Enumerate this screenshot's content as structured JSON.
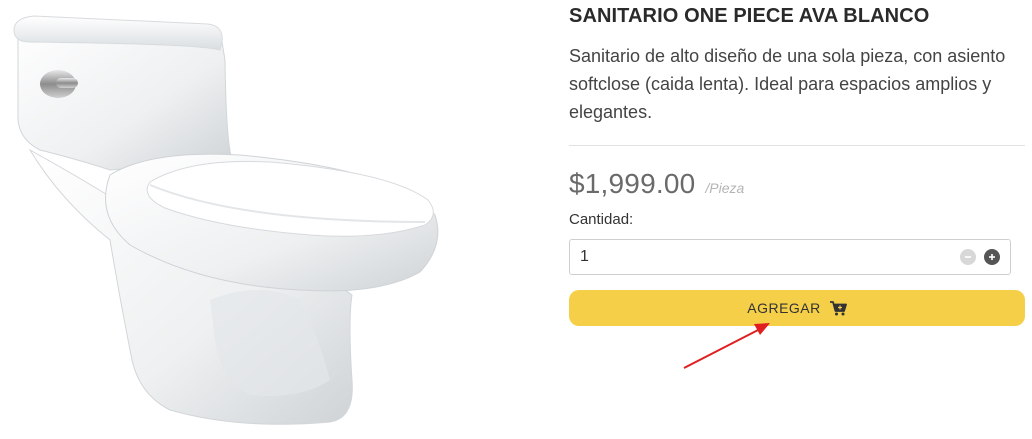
{
  "product": {
    "title": "SANITARIO ONE PIECE AVA BLANCO",
    "description": "Sanitario de alto diseño de una sola pieza, con asiento softclose (caida lenta). Ideal para espacios amplios y elegantes.",
    "price": "$1,999.00",
    "unit": "/Pieza"
  },
  "quantity": {
    "label": "Cantidad:",
    "value": "1"
  },
  "add_button": {
    "label": "AGREGAR",
    "icon": "cart-icon"
  },
  "colors": {
    "accent": "#f5cf48",
    "annotation": "#e02020"
  }
}
